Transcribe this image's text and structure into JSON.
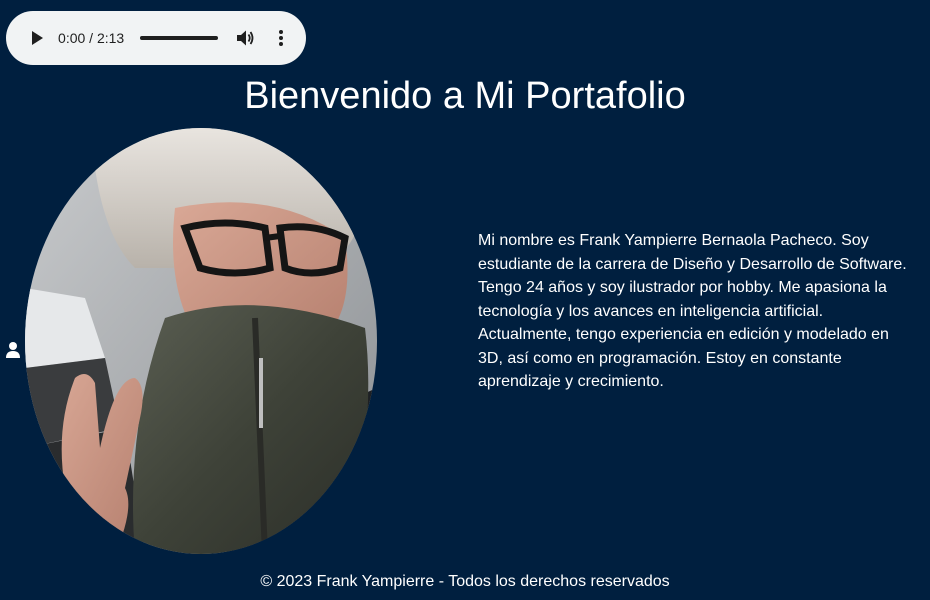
{
  "audio": {
    "time": "0:00 / 2:13",
    "progress_fraction": 0.0,
    "icons": [
      "play-icon",
      "volume-icon",
      "more-vert-icon"
    ]
  },
  "header": {
    "title": "Bienvenido a Mi Portafolio"
  },
  "about": {
    "bio": "Mi nombre es Frank Yampierre Bernaola Pacheco. Soy estudiante de la carrera de Diseño y Desarrollo de Software. Tengo 24 años y soy ilustrador por hobby. Me apasiona la tecnología y los avances en inteligencia artificial. Actualmente, tengo experiencia en edición y modelado en 3D, así como en programación. Estoy en constante aprendizaje y crecimiento."
  },
  "side": {
    "icon": "user-icon"
  },
  "footer": {
    "text": "© 2023 Frank Yampierre - Todos los derechos reservados"
  },
  "colors": {
    "background": "#001f3f",
    "text": "#ffffff",
    "player_background": "#f1f3f4"
  }
}
